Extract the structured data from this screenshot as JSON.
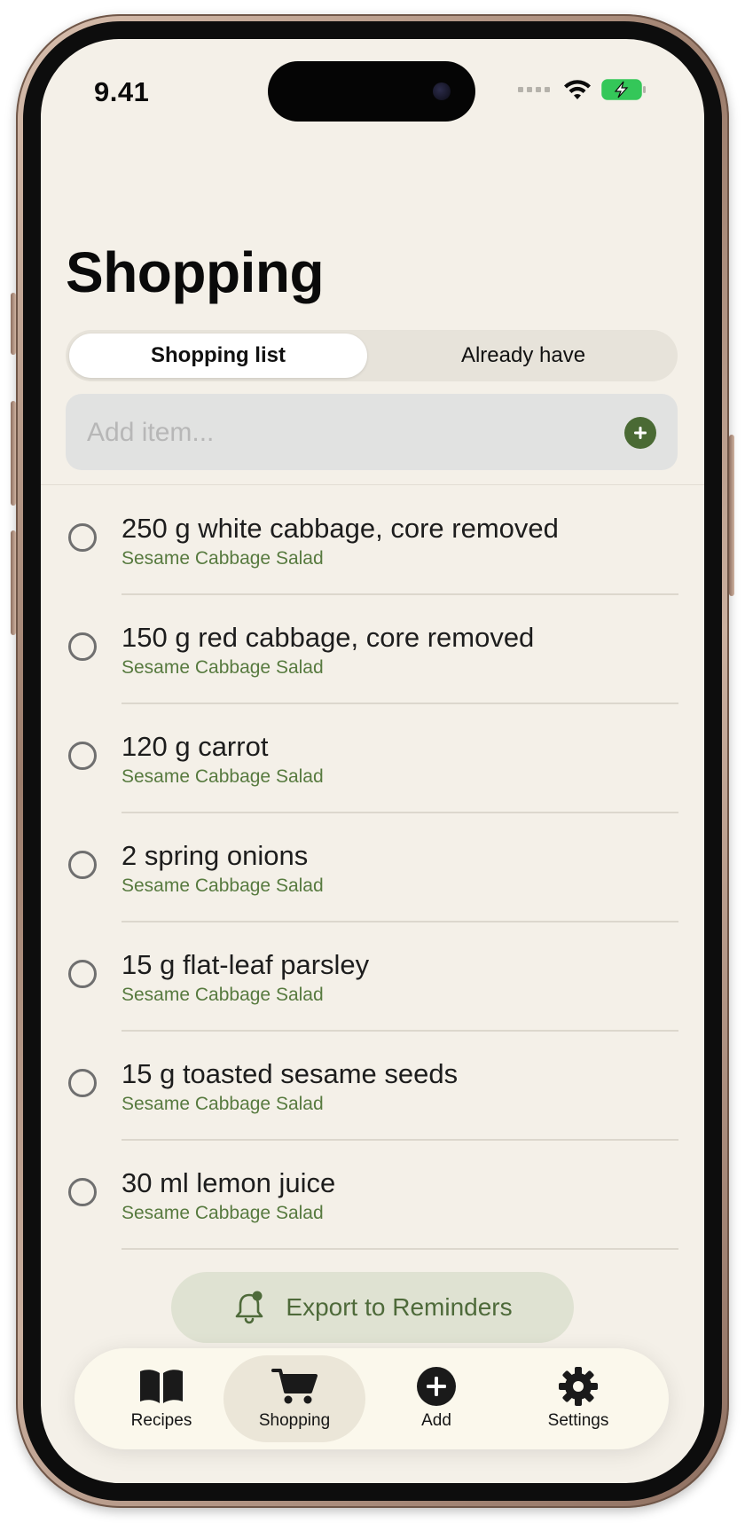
{
  "status_bar": {
    "time": "9.41",
    "icons": [
      "signal-icon",
      "wifi-icon",
      "battery-charging-icon"
    ]
  },
  "header": {
    "title": "Shopping"
  },
  "segmented_control": {
    "options": [
      "Shopping list",
      "Already have"
    ],
    "selected": "Shopping list"
  },
  "add_item": {
    "placeholder": "Add item...",
    "value": "",
    "button_icon": "plus-circle-icon"
  },
  "shopping_list": {
    "items": [
      {
        "name": "250 g white cabbage, core removed",
        "recipe": "Sesame Cabbage Salad",
        "checked": false
      },
      {
        "name": "150 g red cabbage, core removed",
        "recipe": "Sesame Cabbage Salad",
        "checked": false
      },
      {
        "name": "120 g carrot",
        "recipe": "Sesame Cabbage Salad",
        "checked": false
      },
      {
        "name": "2 spring onions",
        "recipe": "Sesame Cabbage Salad",
        "checked": false
      },
      {
        "name": "15 g flat-leaf parsley",
        "recipe": "Sesame Cabbage Salad",
        "checked": false
      },
      {
        "name": "15 g toasted sesame seeds",
        "recipe": "Sesame Cabbage Salad",
        "checked": false
      },
      {
        "name": "30 ml lemon juice",
        "recipe": "Sesame Cabbage Salad",
        "checked": false
      }
    ]
  },
  "export_button": {
    "label": "Export to Reminders",
    "icon": "bell-badge-icon"
  },
  "tab_bar": {
    "selected": "Shopping",
    "tabs": [
      {
        "label": "Recipes",
        "icon": "book-icon"
      },
      {
        "label": "Shopping",
        "icon": "cart-icon"
      },
      {
        "label": "Add",
        "icon": "plus-circle-icon"
      },
      {
        "label": "Settings",
        "icon": "gear-icon"
      }
    ]
  },
  "colors": {
    "background": "#f4f0e8",
    "accent_green": "#4a6a34",
    "recipe_text": "#577a3f",
    "export_button_bg": "#dfe2d2",
    "tab_bar_bg": "#fbf8ec",
    "battery_green": "#34c759"
  }
}
